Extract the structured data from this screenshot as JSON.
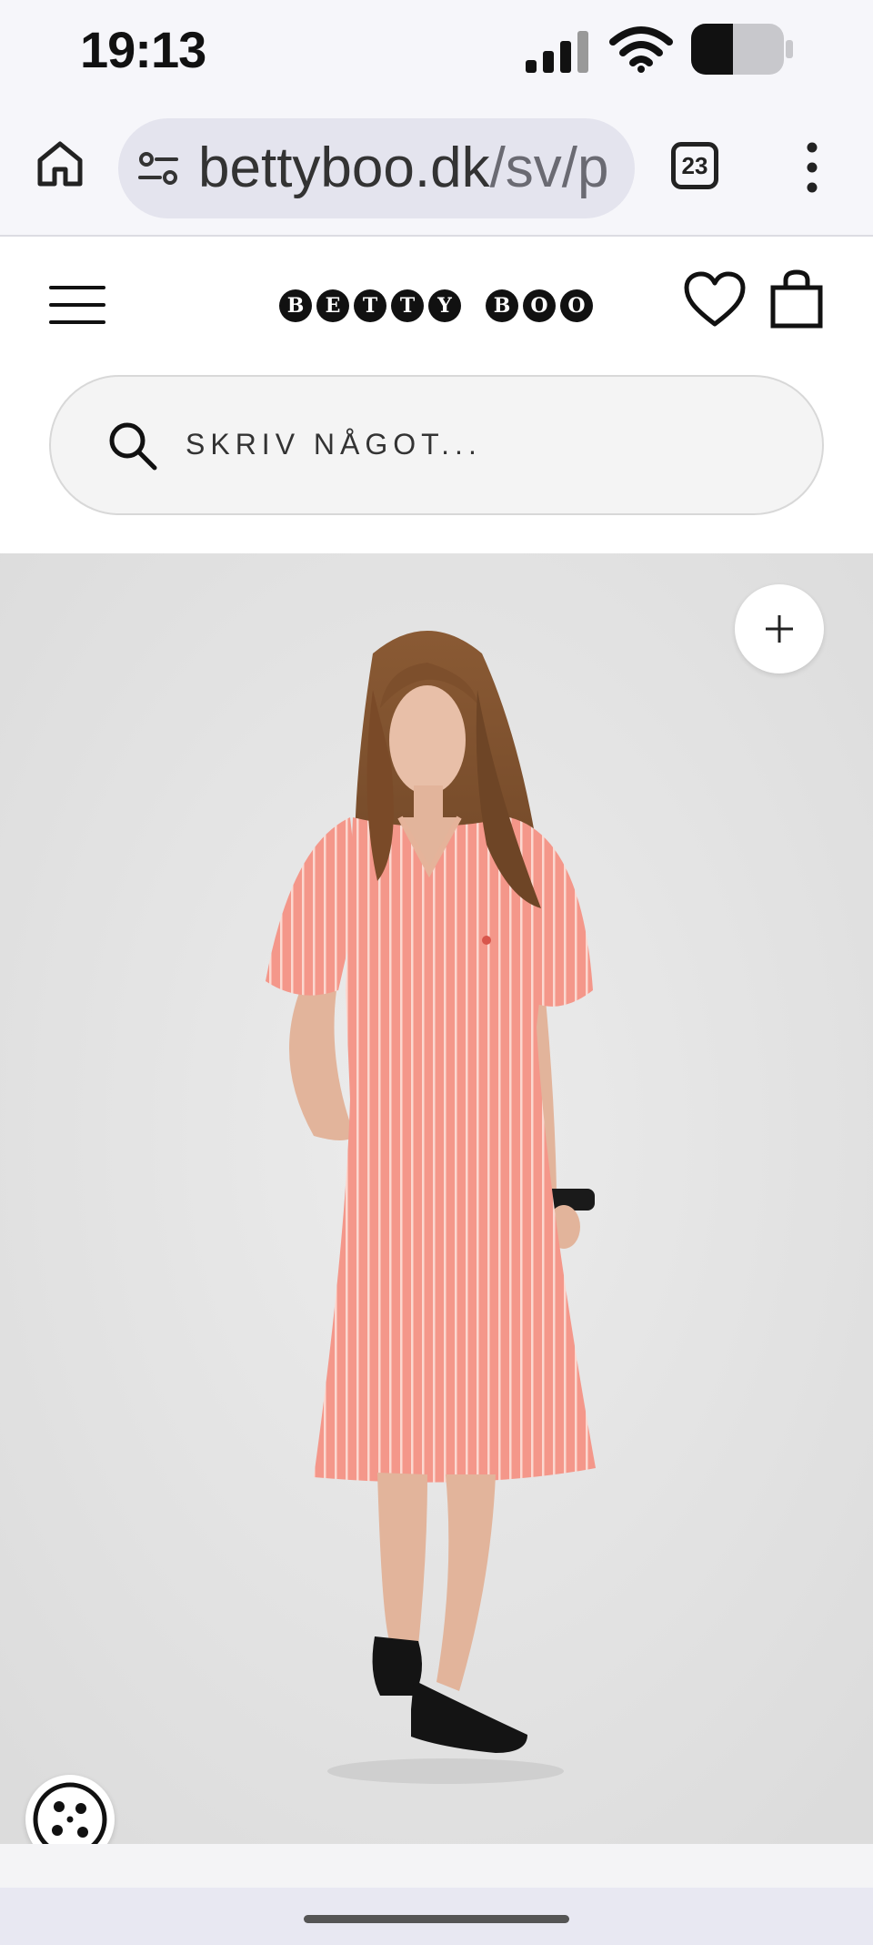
{
  "status_bar": {
    "time": "19:13"
  },
  "browser": {
    "url_domain": "bettyboo.dk",
    "url_path": "/sv/p",
    "tab_count": "23"
  },
  "site": {
    "logo_letters": [
      "B",
      "E",
      "T",
      "T",
      "Y",
      " ",
      "B",
      "O",
      "O"
    ],
    "logo_text": "BETTY BOO",
    "search_placeholder": "SKRIV NÅGOT..."
  },
  "product": {
    "dress_color": "#f29a8e",
    "background_color": "#e4e4e4"
  },
  "icons": {
    "home": "home-icon",
    "site_settings": "tune-icon",
    "menu": "more-vert-icon",
    "hamburger": "hamburger-menu-icon",
    "wishlist": "heart-icon",
    "cart": "shopping-bag-icon",
    "search": "search-icon",
    "zoom": "plus-icon",
    "cookie": "cookie-icon"
  }
}
